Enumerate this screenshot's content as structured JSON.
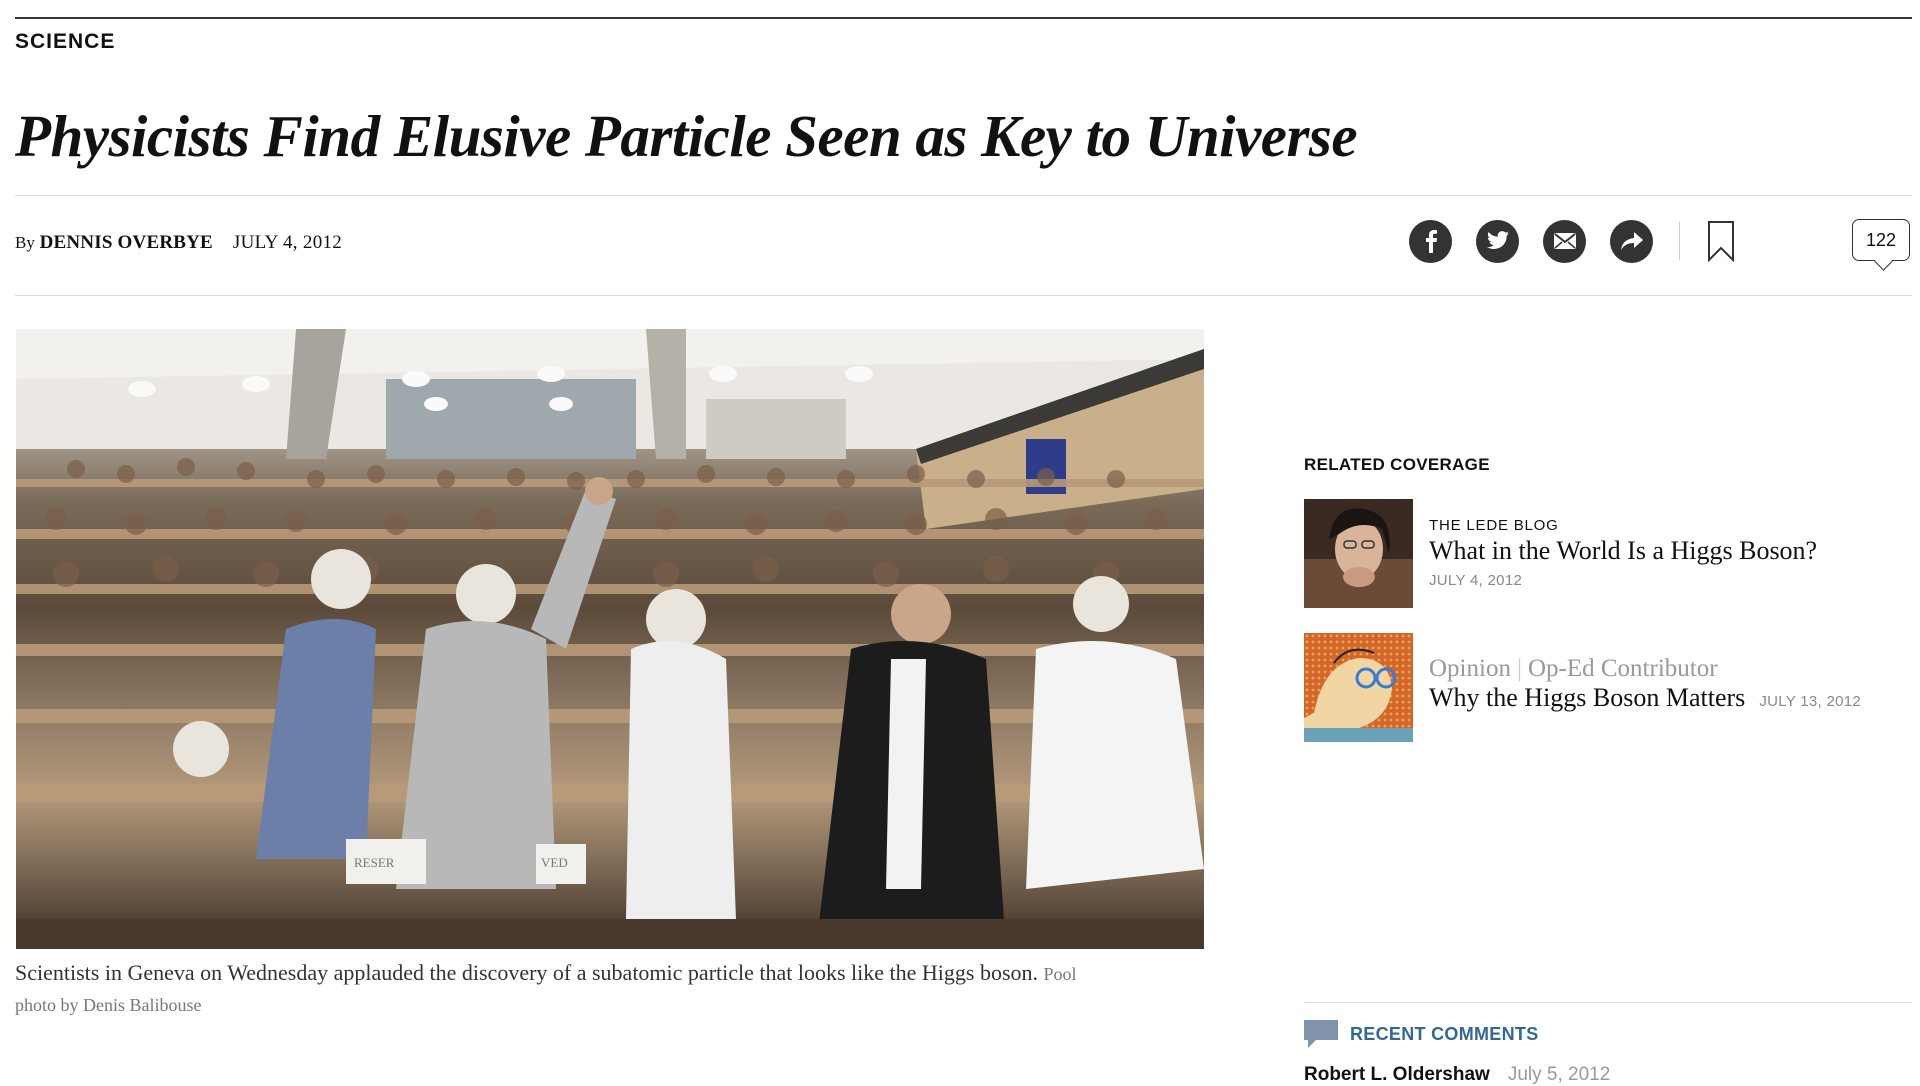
{
  "section": "SCIENCE",
  "headline": "Physicists Find Elusive Particle Seen as Key to Universe",
  "byline": {
    "prefix": "By",
    "author": "DENNIS OVERBYE",
    "date": "JULY 4, 2012"
  },
  "share": {
    "icons": [
      "facebook-icon",
      "twitter-icon",
      "email-icon",
      "share-icon",
      "bookmark-icon"
    ],
    "comment_count": "122"
  },
  "photo": {
    "caption": "Scientists in Geneva on Wednesday applauded the discovery of a subatomic particle that looks like the Higgs boson.",
    "credit": "Pool photo by Denis Balibouse",
    "signs": [
      "RESER",
      "VED"
    ]
  },
  "related": {
    "heading": "RELATED COVERAGE",
    "items": [
      {
        "label": "THE LEDE BLOG",
        "title": "What in the World Is a Higgs Boson?",
        "date": "JULY 4, 2012"
      },
      {
        "opinion": "Opinion",
        "column": "Op-Ed Contributor",
        "title": "Why the Higgs Boson Matters",
        "date": "JULY 13, 2012"
      }
    ]
  },
  "recent_comments": {
    "heading": "RECENT COMMENTS",
    "first": {
      "name": "Robert L. Oldershaw",
      "date": "July 5, 2012"
    }
  },
  "colors": {
    "link_blue": "#326891",
    "icon_dark": "#333333"
  }
}
